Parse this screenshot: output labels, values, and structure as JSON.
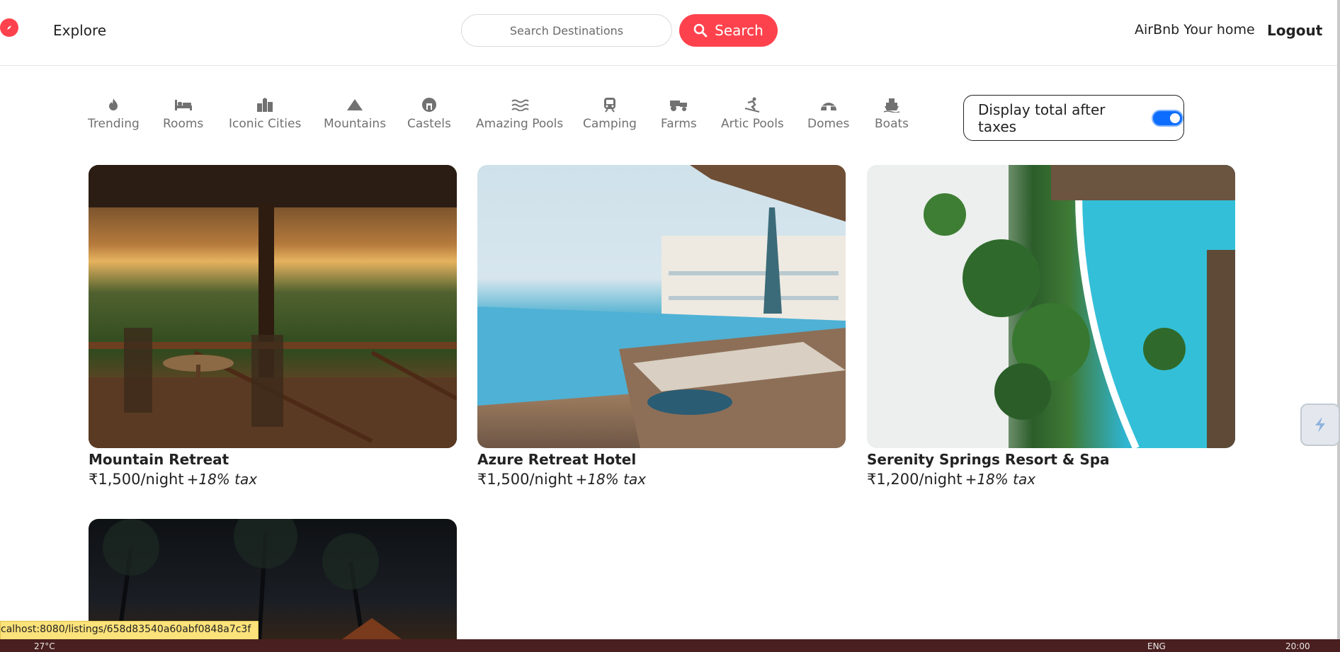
{
  "navbar": {
    "explore_label": "Explore",
    "search_placeholder": "Search Destinations",
    "search_button_label": "Search",
    "host_link_label": "AirBnb Your home",
    "logout_label": "Logout",
    "brand_color": "#fe424d"
  },
  "filters": [
    {
      "label": "Trending",
      "icon": "fire-icon"
    },
    {
      "label": "Rooms",
      "icon": "bed-icon"
    },
    {
      "label": "Iconic Cities",
      "icon": "city-icon"
    },
    {
      "label": "Mountains",
      "icon": "mountain-icon"
    },
    {
      "label": "Castels",
      "icon": "castle-icon"
    },
    {
      "label": "Amazing Pools",
      "icon": "waves-icon"
    },
    {
      "label": "Camping",
      "icon": "train-icon"
    },
    {
      "label": "Farms",
      "icon": "tractor-icon"
    },
    {
      "label": "Artic Pools",
      "icon": "skiing-icon"
    },
    {
      "label": "Domes",
      "icon": "igloo-icon"
    },
    {
      "label": "Boats",
      "icon": "ship-icon"
    }
  ],
  "tax_toggle": {
    "label": "Display total after taxes",
    "enabled": true
  },
  "listings": [
    {
      "title": "Mountain Retreat",
      "price": "₹1,500/night",
      "tax": "+18% tax"
    },
    {
      "title": "Azure Retreat Hotel",
      "price": "₹1,500/night",
      "tax": "+18% tax"
    },
    {
      "title": "Serenity Springs Resort & Spa",
      "price": "₹1,200/night",
      "tax": "+18% tax"
    }
  ],
  "status_bar": {
    "url": "calhost:8080/listings/658d83540a60abf0848a7c3f"
  },
  "taskbar": {
    "weather": "27°C",
    "lang": "ENG",
    "time": "20:00"
  }
}
